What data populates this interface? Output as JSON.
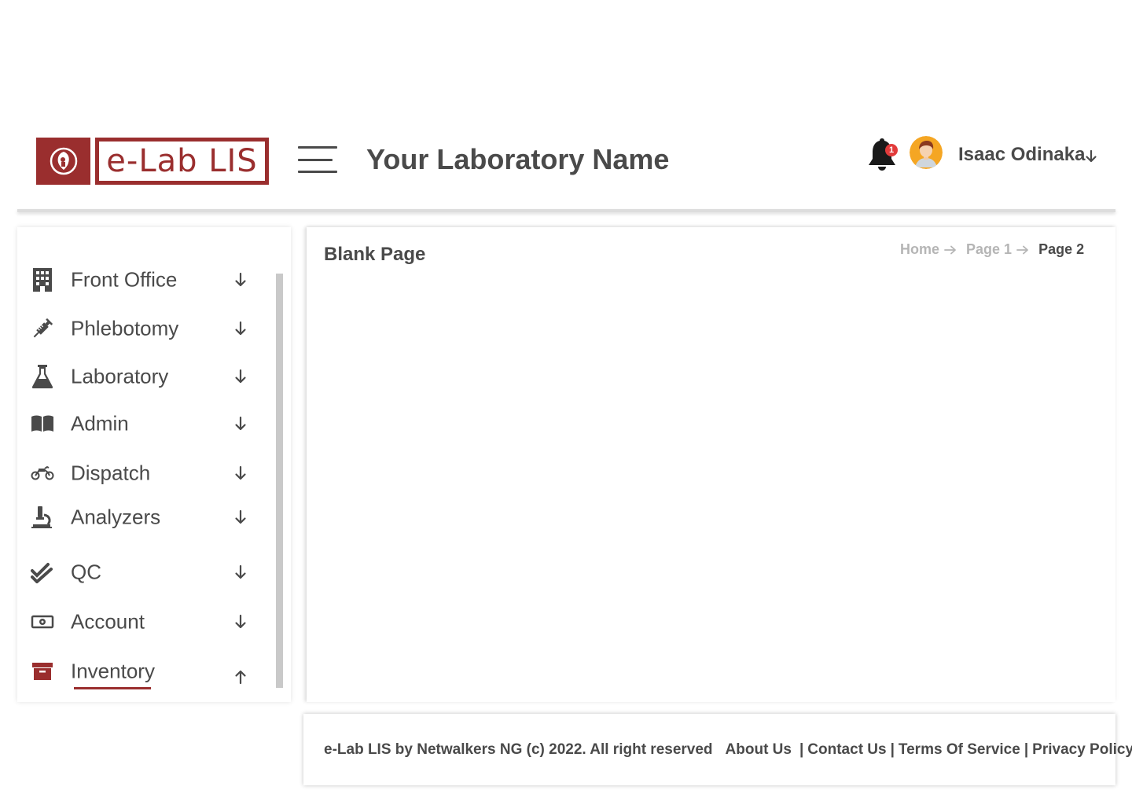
{
  "header": {
    "logo_text": "e-Lab LIS",
    "lab_name": "Your Laboratory Name",
    "notification_count": "1",
    "user_name": "Isaac Odinaka"
  },
  "sidebar": {
    "items": [
      {
        "label": "Front Office",
        "icon": "building-icon",
        "expanded": false
      },
      {
        "label": "Phlebotomy",
        "icon": "syringe-icon",
        "expanded": false
      },
      {
        "label": "Laboratory",
        "icon": "flask-icon",
        "expanded": false
      },
      {
        "label": "Admin",
        "icon": "book-icon",
        "expanded": false
      },
      {
        "label": "Dispatch",
        "icon": "motorcycle-icon",
        "expanded": false
      },
      {
        "label": "Analyzers",
        "icon": "microscope-icon",
        "expanded": false
      },
      {
        "label": "QC",
        "icon": "double-check-icon",
        "expanded": false
      },
      {
        "label": "Account",
        "icon": "money-icon",
        "expanded": false
      },
      {
        "label": "Inventory",
        "icon": "archive-box-icon",
        "expanded": true,
        "active": true
      }
    ]
  },
  "main": {
    "page_title": "Blank Page",
    "breadcrumb": [
      "Home",
      "Page 1",
      "Page 2"
    ]
  },
  "footer": {
    "copyright": "e-Lab LIS by Netwalkers NG (c) 2022. All right reserved",
    "links": [
      "About Us",
      "Contact Us",
      "Terms Of Service",
      "Privacy Policy"
    ]
  },
  "colors": {
    "brand": "#9a2e2e",
    "text": "#4a4a4a",
    "muted": "#b5b5b5",
    "badge": "#e23b3b",
    "avatar_bg": "#f5a623"
  }
}
